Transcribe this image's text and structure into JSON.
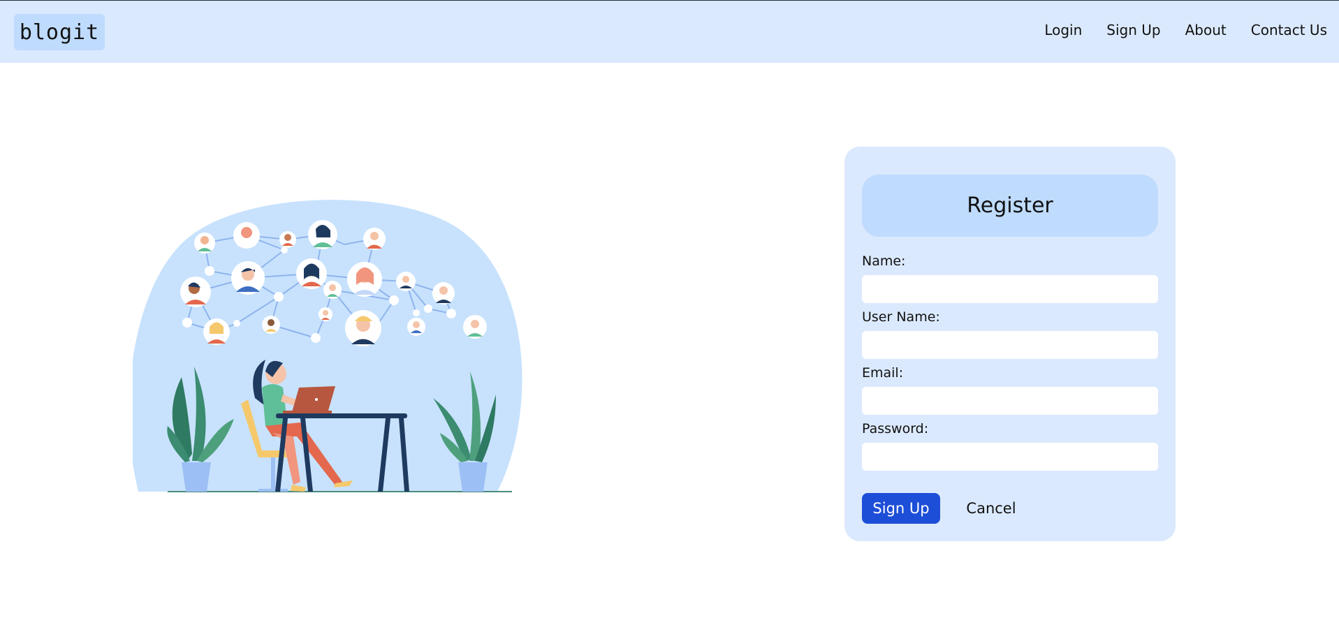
{
  "header": {
    "logo": "blogit",
    "nav": [
      {
        "label": "Login"
      },
      {
        "label": "Sign Up"
      },
      {
        "label": "About"
      },
      {
        "label": "Contact Us"
      }
    ]
  },
  "register": {
    "title": "Register",
    "fields": [
      {
        "label": "Name:",
        "value": ""
      },
      {
        "label": "User Name:",
        "value": ""
      },
      {
        "label": "Email:",
        "value": ""
      },
      {
        "label": "Password:",
        "value": ""
      }
    ],
    "submit_label": "Sign Up",
    "cancel_label": "Cancel"
  },
  "colors": {
    "header_bg": "#dbe9fe",
    "card_bg": "#dbe9fe",
    "accent": "#1d4ed8",
    "soft_blue": "#bfdbfe"
  },
  "illustration": {
    "icon": "social-network-woman-laptop-illustration"
  }
}
